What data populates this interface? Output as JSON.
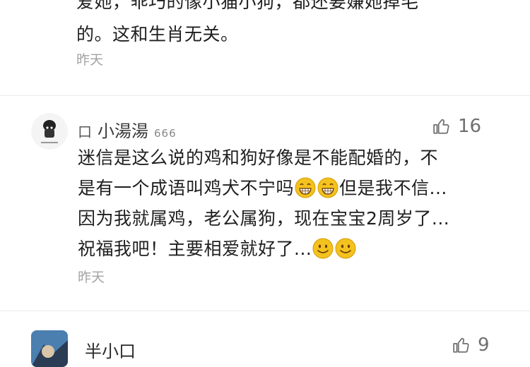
{
  "comment_top": {
    "lines": [
      "爱她，乖巧的像小猫小狗，都还要嫌她掉毛",
      "的。这和生肖无关。"
    ],
    "time": "昨天"
  },
  "comment_main": {
    "prefix": "口",
    "username": "小湯湯",
    "level": "666",
    "likes": "16",
    "lines": [
      "迷信是这么说的鸡和狗好像是不能配婚的，不",
      "是有一个成语叫鸡犬不宁吗",
      "但是我不信...",
      "因为我就属鸡，老公属狗，现在宝宝2周岁了...",
      "祝福我吧！主要相爱就好了..."
    ],
    "time": "昨天"
  },
  "comment_next": {
    "username": "半小口",
    "likes": "9"
  },
  "icons": {
    "like": "thumbs-up-icon",
    "grin": "grinning-emoji",
    "smile": "smiling-emoji"
  },
  "colors": {
    "text": "#1f1f1f",
    "meta": "#a3a3a3",
    "emoji": "#f4c21f"
  }
}
